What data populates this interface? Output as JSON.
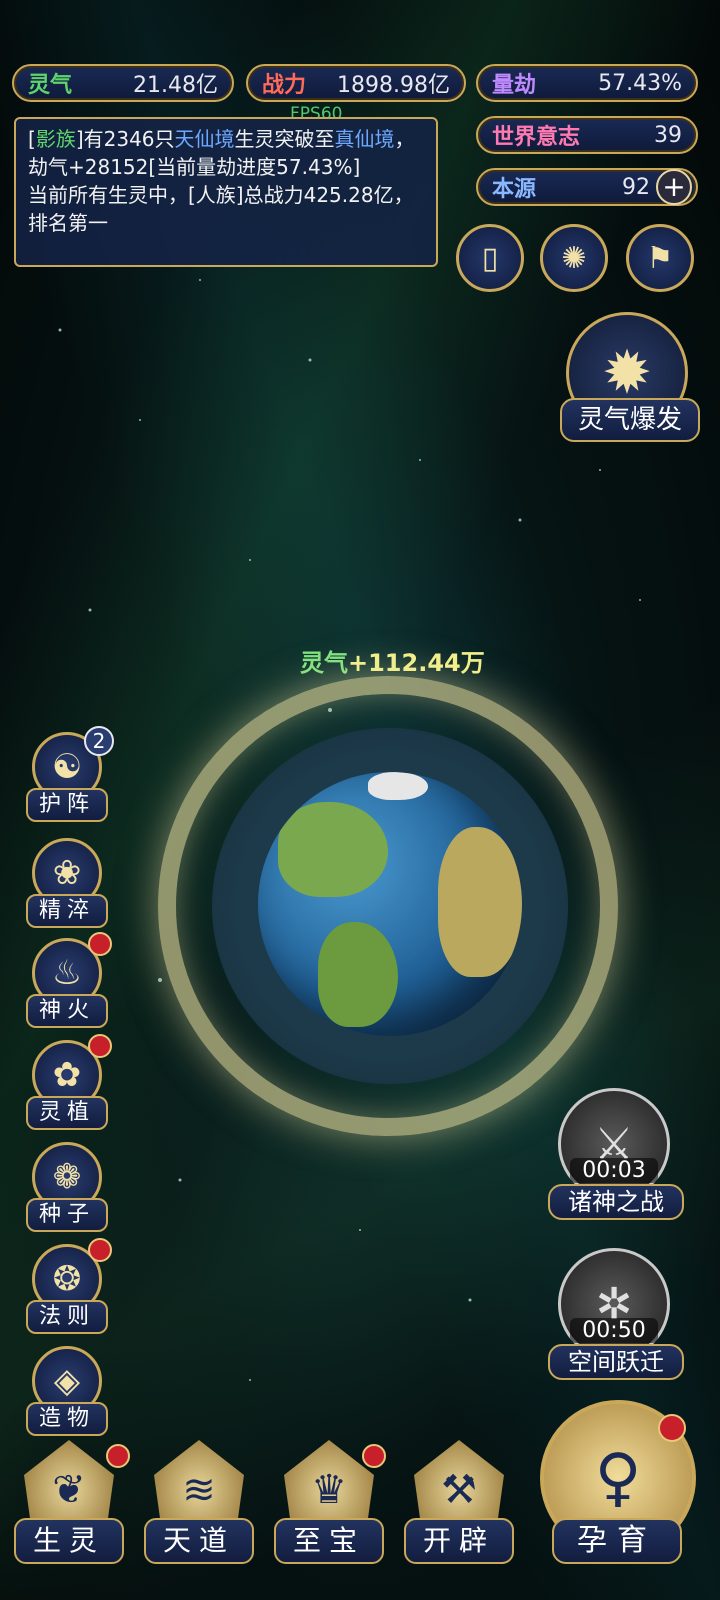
{
  "resources": {
    "lingqi": {
      "label": "灵气",
      "value": "21.48亿"
    },
    "zhanli": {
      "label": "战力",
      "value": "1898.98亿"
    },
    "liangjie": {
      "label": "量劫",
      "value": "57.43%"
    },
    "shijie": {
      "label": "世界意志",
      "value": "39"
    },
    "benyuan": {
      "label": "本源",
      "value": "92"
    }
  },
  "fps": "FPS60",
  "log": {
    "p1_a": "[",
    "p1_race": "影族",
    "p1_b": "]有2346只",
    "p1_realm": "天仙境",
    "p1_c": "生灵突破至",
    "p1_realm2": "真仙境",
    "p1_d": "，劫气+28152[当前量劫进度57.43%]",
    "p2": "当前所有生灵中，[人族]总战力425.28亿，排名第一"
  },
  "burst_label": "灵气爆发",
  "gain": {
    "key": "灵气",
    "value": "+112.44万"
  },
  "left_menu": [
    {
      "label": "护阵",
      "badge": "2"
    },
    {
      "label": "精淬"
    },
    {
      "label": "神火"
    },
    {
      "label": "灵植"
    },
    {
      "label": "种子"
    },
    {
      "label": "法则"
    },
    {
      "label": "造物"
    }
  ],
  "timers": [
    {
      "label": "诸神之战",
      "time": "00:03"
    },
    {
      "label": "空间跃迁",
      "time": "00:50"
    }
  ],
  "bottom_nav": [
    {
      "label": "生灵"
    },
    {
      "label": "天道"
    },
    {
      "label": "至宝"
    },
    {
      "label": "开辟"
    }
  ],
  "main_action": {
    "label": "孕育"
  },
  "colors": {
    "gold": "#c9a85a",
    "panel": "#1a2a55",
    "green": "#5fd46b",
    "blue": "#6ea8ff",
    "red_dot": "#c8202a"
  }
}
